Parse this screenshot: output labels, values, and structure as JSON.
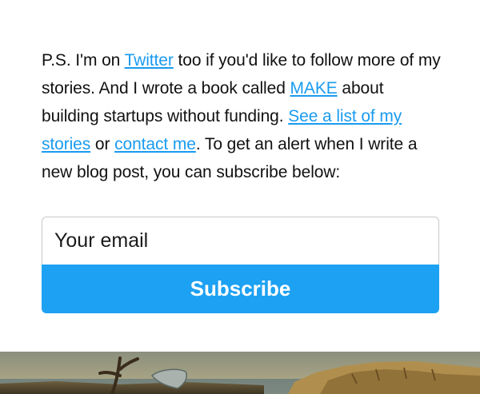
{
  "postscript": {
    "part1": "P.S. I'm on ",
    "twitter_link": "Twitter",
    "part2": " too if you'd like to follow more of my stories. And I wrote a book called ",
    "make_link": "MAKE",
    "part3": " about building startups without funding. ",
    "stories_link": "See a list of my stories",
    "part4": " or ",
    "contact_link": "contact me",
    "part5": ". To get an alert when I write a new blog post, you can subscribe below:"
  },
  "subscribe": {
    "email_placeholder": "Your email",
    "email_value": "",
    "button_label": "Subscribe"
  },
  "colors": {
    "link": "#1a9bef",
    "button_bg": "#1da1f2",
    "button_text": "#ffffff"
  }
}
